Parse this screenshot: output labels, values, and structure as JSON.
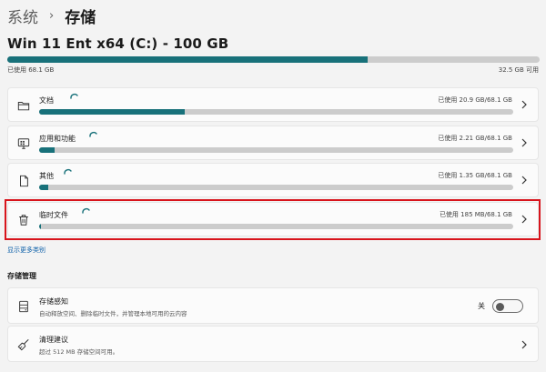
{
  "breadcrumb": {
    "parent": "系统",
    "separator": "›",
    "current": "存储"
  },
  "drive": {
    "title": "Win 11 Ent x64 (C:) - 100 GB",
    "used_fraction": 0.677,
    "used_label": "已使用 68.1 GB",
    "free_label": "32.5 GB 可用"
  },
  "categories": [
    {
      "name": "文档",
      "icon": "folder-icon",
      "usage": "已使用 20.9 GB/68.1 GB",
      "fraction": 0.307
    },
    {
      "name": "应用和功能",
      "icon": "apps-monitor-icon",
      "usage": "已使用 2.21 GB/68.1 GB",
      "fraction": 0.032
    },
    {
      "name": "其他",
      "icon": "document-icon",
      "usage": "已使用 1.35 GB/68.1 GB",
      "fraction": 0.02
    },
    {
      "name": "临时文件",
      "icon": "trash-icon",
      "usage": "已使用 185 MB/68.1 GB",
      "fraction": 0.003
    }
  ],
  "more_link": "显示更多类别",
  "management": {
    "heading": "存储管理",
    "storage_sense": {
      "title": "存储感知",
      "description": "自动释放空间、删除临时文件，并管理本地可用的云内容",
      "toggle_label": "关",
      "toggle_on": false
    },
    "cleanup": {
      "title": "清理建议",
      "description": "超过 512 MB 存储空间可用。"
    }
  },
  "colors": {
    "accent": "#18717a",
    "highlight": "#d8141c",
    "link": "#0a5ea8"
  }
}
